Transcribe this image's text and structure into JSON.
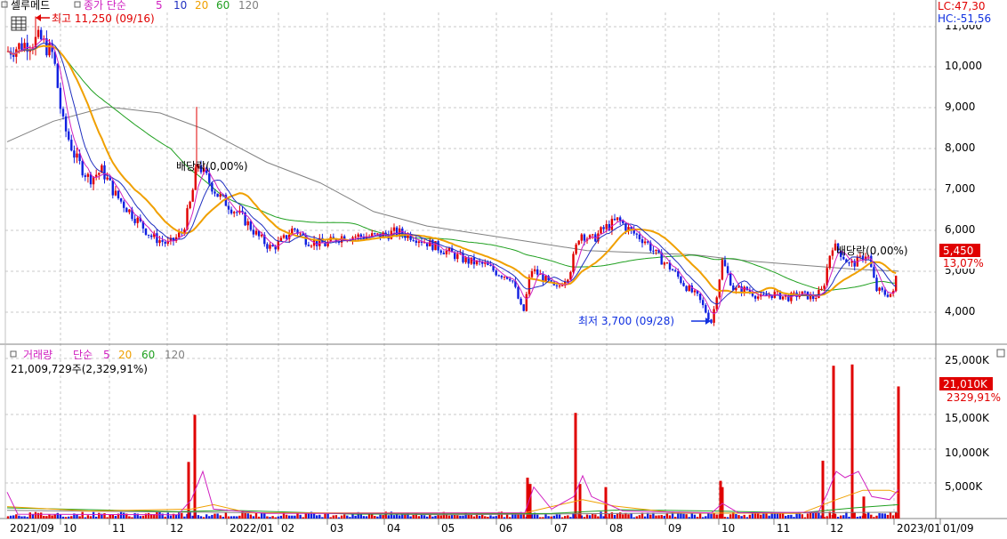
{
  "price_panel": {
    "stock_name": "셀루메드",
    "legend_title": "종가 단순",
    "ma_labels": [
      "5",
      "10",
      "20",
      "60",
      "120"
    ],
    "ma_colors": [
      "#d020c0",
      "#2030c0",
      "#f0a000",
      "#20a020",
      "#808080"
    ],
    "lc_label": "LC:47,30",
    "hc_label": "HC:-51,56",
    "high_label": "최고 11,250 (09/16)",
    "low_label": "최저 3,700 (09/28)",
    "dividend_label": "배당락(0,00%)",
    "price_tag": "5,450",
    "change_tag": "13,07%",
    "y_ticks": [
      "11,000",
      "10,000",
      "9,000",
      "8,000",
      "7,000",
      "6,000",
      "5,000",
      "4,000"
    ]
  },
  "volume_panel": {
    "legend_title": "거래량",
    "legend_ma": "단순",
    "ma_labels": [
      "5",
      "20",
      "60",
      "120"
    ],
    "volume_text": "21,009,729주(2,329,91%)",
    "volume_tag": "21,010K",
    "volume_pct_tag": "2329,91%",
    "y_ticks": [
      "25,000K",
      "20,000K",
      "15,000K",
      "10,000K",
      "5,000K"
    ]
  },
  "x_axis": {
    "labels": [
      "2021/09",
      "10",
      "11",
      "12",
      "2022/01",
      "02",
      "03",
      "04",
      "05",
      "06",
      "07",
      "08",
      "09",
      "10",
      "11",
      "12",
      "2023/01",
      "01/09"
    ]
  },
  "chart_data": [
    {
      "type": "line",
      "title": "셀루메드 종가",
      "x": [
        "2021/09",
        "2021/10",
        "2021/11",
        "2021/12",
        "2022/01",
        "2022/02",
        "2022/03",
        "2022/04",
        "2022/05",
        "2022/06",
        "2022/07",
        "2022/08",
        "2022/09",
        "2022/10",
        "2022/11",
        "2022/12",
        "2023/01"
      ],
      "series": [
        {
          "name": "종가",
          "values": [
            10600,
            10000,
            7200,
            5900,
            6800,
            5900,
            5900,
            5900,
            5300,
            4800,
            5000,
            6000,
            4600,
            4500,
            4400,
            5200,
            5450
          ]
        }
      ],
      "ylim": [
        3500,
        11300
      ],
      "annotations": [
        "최고 11,250 (09/16)",
        "최저 3,700 (09/28)",
        "배당락(0,00%)"
      ]
    },
    {
      "type": "bar",
      "title": "거래량",
      "x": [
        "2021/12",
        "2022/06",
        "2022/07",
        "2022/10",
        "2022/12",
        "2023/01"
      ],
      "series": [
        {
          "name": "거래량 spikes (K)",
          "values": [
            16500,
            6500,
            16800,
            6000,
            24500,
            21010
          ]
        }
      ],
      "ylim": [
        0,
        26000
      ]
    }
  ]
}
